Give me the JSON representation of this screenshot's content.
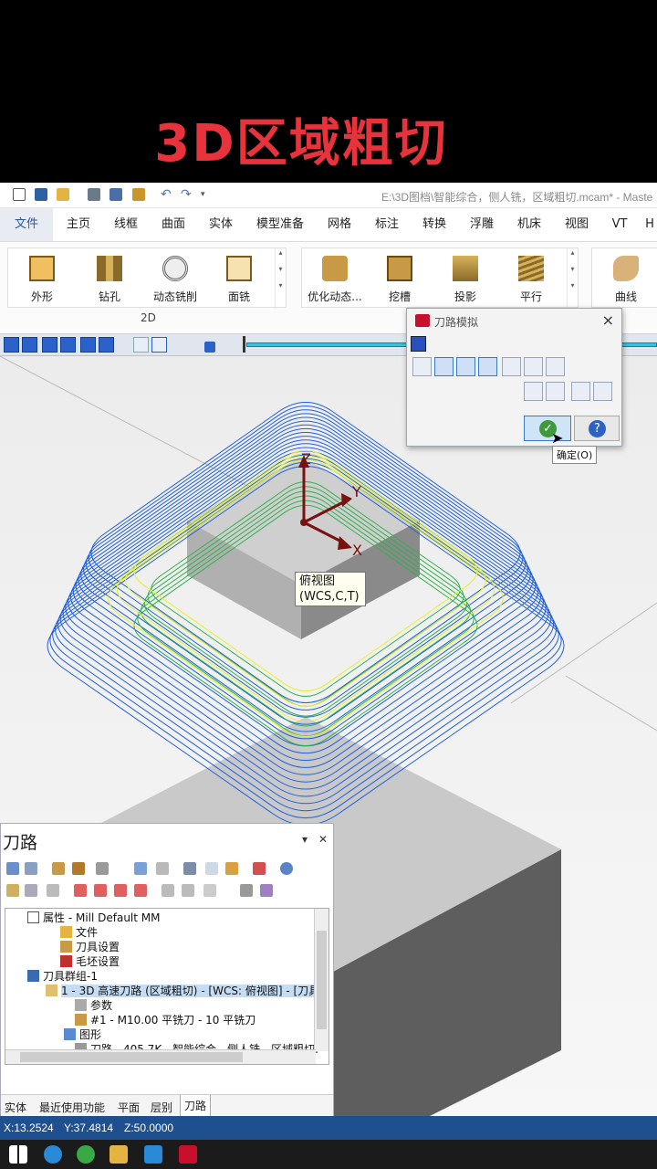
{
  "banner": {
    "title": "3D区域粗切"
  },
  "window": {
    "title": "E:\\3D图档\\智能综合，侧人铣，区域粗切.mcam* - Maste"
  },
  "ribbon_tabs": [
    "文件",
    "主页",
    "线框",
    "曲面",
    "实体",
    "模型准备",
    "网格",
    "标注",
    "转换",
    "浮雕",
    "机床",
    "视图",
    "VT",
    "H"
  ],
  "ribbon": {
    "group_2d": {
      "label": "2D",
      "buttons": [
        "外形",
        "钻孔",
        "动态铣削",
        "面铣"
      ]
    },
    "group_3d": {
      "buttons": [
        "优化动态...",
        "挖槽",
        "投影",
        "平行"
      ]
    },
    "group_extra": {
      "buttons": [
        "曲线"
      ]
    }
  },
  "viewport": {
    "axis_z": "Z",
    "axis_y": "Y",
    "axis_x": "X",
    "view_label_line1": "俯视图",
    "view_label_line2": "(WCS,C,T)"
  },
  "sim_dialog": {
    "title": "刀路模拟",
    "ok_tooltip": "确定(O)"
  },
  "toolpath_manager": {
    "title": "刀路",
    "pin": "▾",
    "close": "✕",
    "tree": [
      {
        "text": "属性 - Mill Default MM",
        "icon": "properties-icon"
      },
      {
        "text": "文件",
        "icon": "folder-icon"
      },
      {
        "text": "刀具设置",
        "icon": "tool-settings-icon"
      },
      {
        "text": "毛坯设置",
        "icon": "stock-icon"
      },
      {
        "text": "刀具群组-1",
        "icon": "group-icon"
      },
      {
        "text": "1 - 3D 高速刀路 (区域粗切) - [WCS: 俯视图] - [刀具",
        "icon": "operation-icon"
      },
      {
        "text": "参数",
        "icon": "parameters-icon"
      },
      {
        "text": "#1 - M10.00 平铣刀 - 10 平铣刀",
        "icon": "tool-icon"
      },
      {
        "text": "图形",
        "icon": "geometry-icon"
      },
      {
        "text": "刀路 - 405.7K - 智能综合，侧人铣，区域粗切.",
        "icon": "toolpath-icon"
      }
    ],
    "bottom_tabs": [
      "实体",
      "最近使用功能",
      "平面",
      "层别",
      "刀路"
    ],
    "active_tab": "刀路"
  },
  "status": {
    "x": "X:13.2524",
    "y": "Y:37.4814",
    "z": "Z:50.0000"
  },
  "colors": {
    "banner_text": "#e8333d",
    "toolpath_blue": "#1f5fe0",
    "toolpath_green": "#2fb04a",
    "toolpath_yellow": "#e6f02a",
    "status_bar": "#1e4f8f"
  }
}
